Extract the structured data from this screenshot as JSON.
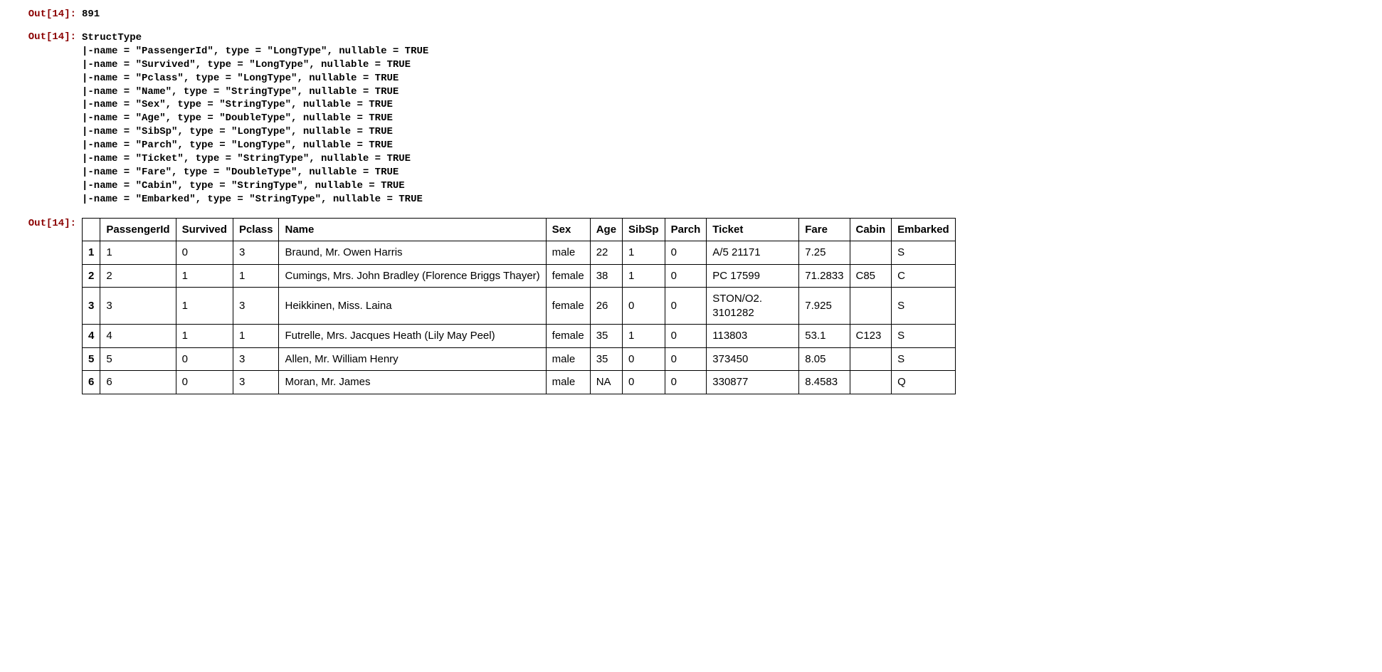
{
  "prompts": {
    "out1": "Out[14]:",
    "out2": "Out[14]:",
    "out3": "Out[14]:"
  },
  "count_output": "891",
  "schema_lines": [
    "StructType",
    "|-name = \"PassengerId\", type = \"LongType\", nullable = TRUE",
    "|-name = \"Survived\", type = \"LongType\", nullable = TRUE",
    "|-name = \"Pclass\", type = \"LongType\", nullable = TRUE",
    "|-name = \"Name\", type = \"StringType\", nullable = TRUE",
    "|-name = \"Sex\", type = \"StringType\", nullable = TRUE",
    "|-name = \"Age\", type = \"DoubleType\", nullable = TRUE",
    "|-name = \"SibSp\", type = \"LongType\", nullable = TRUE",
    "|-name = \"Parch\", type = \"LongType\", nullable = TRUE",
    "|-name = \"Ticket\", type = \"StringType\", nullable = TRUE",
    "|-name = \"Fare\", type = \"DoubleType\", nullable = TRUE",
    "|-name = \"Cabin\", type = \"StringType\", nullable = TRUE",
    "|-name = \"Embarked\", type = \"StringType\", nullable = TRUE"
  ],
  "table": {
    "columns": [
      "PassengerId",
      "Survived",
      "Pclass",
      "Name",
      "Sex",
      "Age",
      "SibSp",
      "Parch",
      "Ticket",
      "Fare",
      "Cabin",
      "Embarked"
    ],
    "rows": [
      {
        "idx": "1",
        "PassengerId": "1",
        "Survived": "0",
        "Pclass": "3",
        "Name": "Braund, Mr. Owen Harris",
        "Sex": "male",
        "Age": "22",
        "SibSp": "1",
        "Parch": "0",
        "Ticket": "A/5 21171",
        "Fare": "7.25",
        "Cabin": "",
        "Embarked": "S"
      },
      {
        "idx": "2",
        "PassengerId": "2",
        "Survived": "1",
        "Pclass": "1",
        "Name": "Cumings, Mrs. John Bradley (Florence Briggs Thayer)",
        "Sex": "female",
        "Age": "38",
        "SibSp": "1",
        "Parch": "0",
        "Ticket": "PC 17599",
        "Fare": "71.2833",
        "Cabin": "C85",
        "Embarked": "C"
      },
      {
        "idx": "3",
        "PassengerId": "3",
        "Survived": "1",
        "Pclass": "3",
        "Name": "Heikkinen, Miss. Laina",
        "Sex": "female",
        "Age": "26",
        "SibSp": "0",
        "Parch": "0",
        "Ticket": "STON/O2. 3101282",
        "Fare": "7.925",
        "Cabin": "",
        "Embarked": "S"
      },
      {
        "idx": "4",
        "PassengerId": "4",
        "Survived": "1",
        "Pclass": "1",
        "Name": "Futrelle, Mrs. Jacques Heath (Lily May Peel)",
        "Sex": "female",
        "Age": "35",
        "SibSp": "1",
        "Parch": "0",
        "Ticket": "113803",
        "Fare": "53.1",
        "Cabin": "C123",
        "Embarked": "S"
      },
      {
        "idx": "5",
        "PassengerId": "5",
        "Survived": "0",
        "Pclass": "3",
        "Name": "Allen, Mr. William Henry",
        "Sex": "male",
        "Age": "35",
        "SibSp": "0",
        "Parch": "0",
        "Ticket": "373450",
        "Fare": "8.05",
        "Cabin": "",
        "Embarked": "S"
      },
      {
        "idx": "6",
        "PassengerId": "6",
        "Survived": "0",
        "Pclass": "3",
        "Name": "Moran, Mr. James",
        "Sex": "male",
        "Age": "NA",
        "SibSp": "0",
        "Parch": "0",
        "Ticket": "330877",
        "Fare": "8.4583",
        "Cabin": "",
        "Embarked": "Q"
      }
    ]
  }
}
